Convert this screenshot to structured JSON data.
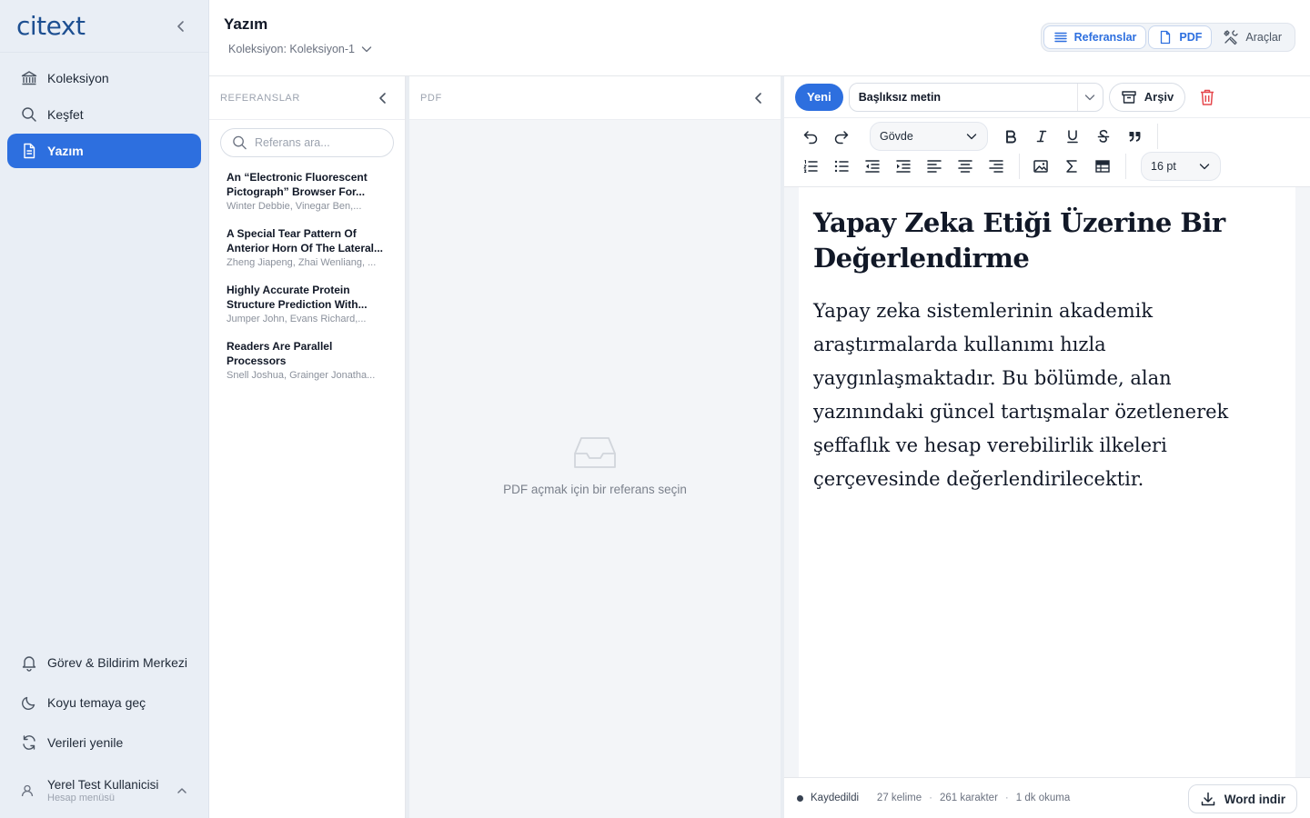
{
  "app": {
    "logo": "citext",
    "page_title": "Yazım",
    "collection_label": "Koleksiyon: Koleksiyon-1"
  },
  "sidebar": {
    "items": [
      {
        "label": "Koleksiyon",
        "icon": "bank-icon"
      },
      {
        "label": "Keşfet",
        "icon": "search-icon"
      },
      {
        "label": "Yazım",
        "icon": "document-icon",
        "active": true
      }
    ],
    "bottom_items": [
      {
        "label": "Görev & Bildirim Merkezi",
        "icon": "bell-icon"
      },
      {
        "label": "Koyu temaya geç",
        "icon": "moon-icon"
      },
      {
        "label": "Verileri yenile",
        "icon": "refresh-icon"
      }
    ],
    "user": {
      "name": "Yerel Test Kullanicisi",
      "subtitle": "Hesap menüsü"
    }
  },
  "view_toggles": {
    "references": "Referanslar",
    "pdf": "PDF",
    "tools": "Araçlar"
  },
  "references_panel": {
    "header": "REFERANSLAR",
    "search_placeholder": "Referans ara...",
    "items": [
      {
        "title": "An “Electronic Fluorescent Pictograph” Browser For...",
        "authors": "Winter Debbie, Vinegar Ben,..."
      },
      {
        "title": "A Special Tear Pattern Of Anterior Horn Of The Lateral...",
        "authors": "Zheng Jiapeng, Zhai Wenliang, ..."
      },
      {
        "title": "Highly Accurate Protein Structure Prediction With...",
        "authors": "Jumper John, Evans Richard,..."
      },
      {
        "title": "Readers Are Parallel Processors",
        "authors": "Snell Joshua, Grainger Jonatha..."
      }
    ]
  },
  "pdf_panel": {
    "header": "PDF",
    "empty_text": "PDF açmak için bir referans seçin"
  },
  "editor": {
    "new_label": "Yeni",
    "document_name": "Başlıksız metin",
    "archive_label": "Arşiv",
    "paragraph_style": "Gövde",
    "font_size": "16 pt",
    "document": {
      "title": "Yapay Zeka Etiği Üzerine Bir Değerlendirme",
      "body": "Yapay zeka sistemlerinin akademik araştırmalarda kullanımı hızla yaygınlaşmaktadır. Bu bölümde, alan yazınındaki güncel tartışmalar özetlenerek şeffaflık ve hesap verebilirlik ilkeleri çerçevesinde değerlendirilecektir."
    },
    "status": {
      "saved": "Kaydedildi",
      "words": "27 kelime",
      "chars": "261 karakter",
      "reading": "1 dk okuma",
      "separator": "·"
    },
    "download_label": "Word indir"
  },
  "colors": {
    "accent": "#2d6fdf",
    "sidebar_bg": "#e9eef5",
    "danger": "#e5484d"
  }
}
